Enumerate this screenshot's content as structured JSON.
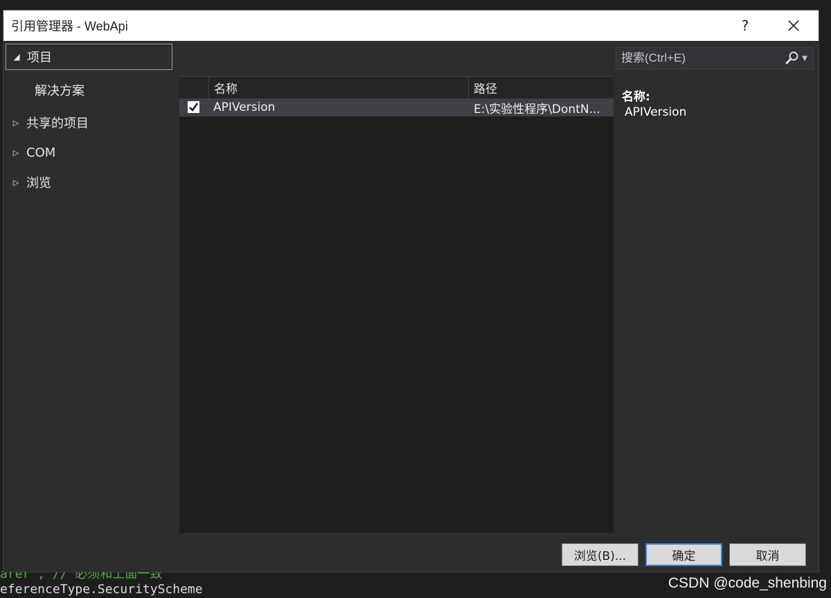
{
  "window": {
    "title": "引用管理器 - WebApi",
    "help_glyph": "?",
    "close_glyph": "✕"
  },
  "tree": {
    "items": [
      {
        "label": "项目",
        "expanded": true,
        "selected": true
      },
      {
        "label": "解决方案",
        "indent": true
      },
      {
        "label": "共享的项目",
        "expanded": false
      },
      {
        "label": "COM",
        "expanded": false
      },
      {
        "label": "浏览",
        "expanded": false
      }
    ]
  },
  "search": {
    "placeholder": "搜索(Ctrl+E)"
  },
  "list": {
    "columns": [
      "名称",
      "路径"
    ],
    "rows": [
      {
        "checked": true,
        "name": "APIVersion",
        "path": "E:\\实验性程序\\DontN..."
      }
    ]
  },
  "detail": {
    "label": "名称:",
    "value": "APIVersion"
  },
  "buttons": {
    "browse": "浏览(B)...",
    "ok": "确定",
    "cancel": "取消"
  },
  "background": {
    "code_line1": "arer\", // 必须和上面一致",
    "code_line2": "eferenceType.SecurityScheme",
    "watermark": "CSDN @code_shenbing"
  }
}
